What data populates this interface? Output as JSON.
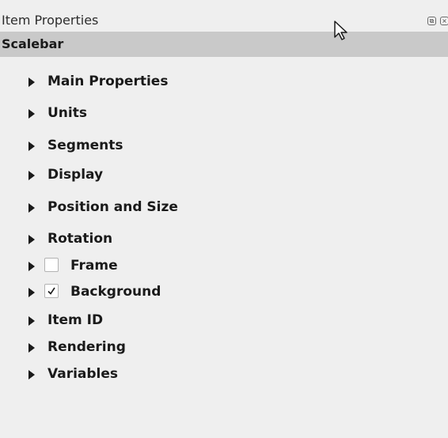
{
  "panel": {
    "title": "Item Properties"
  },
  "item": {
    "type": "Scalebar"
  },
  "sections": [
    {
      "label": "Main Properties"
    },
    {
      "label": "Units"
    },
    {
      "label": "Segments"
    },
    {
      "label": "Display"
    },
    {
      "label": "Position and Size"
    },
    {
      "label": "Rotation"
    },
    {
      "label": "Frame",
      "checked": false
    },
    {
      "label": "Background",
      "checked": true
    },
    {
      "label": "Item ID"
    },
    {
      "label": "Rendering"
    },
    {
      "label": "Variables"
    }
  ],
  "icons": {
    "expand": "triangle-right-icon",
    "float": "float-panel-icon",
    "close": "close-icon",
    "cursor": "mouse-pointer-icon"
  }
}
